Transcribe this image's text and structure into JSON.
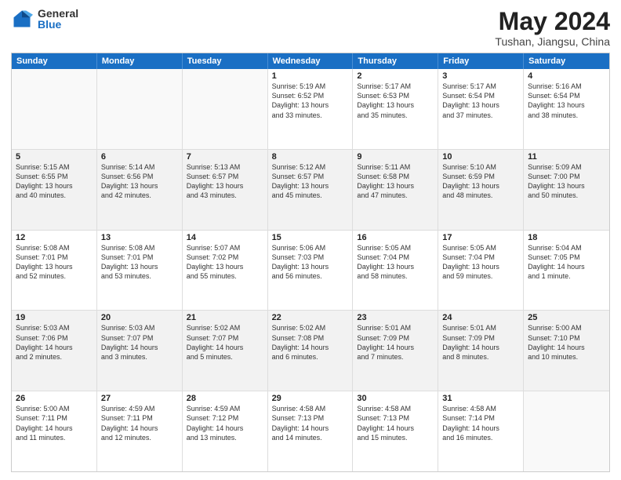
{
  "header": {
    "logo": {
      "general": "General",
      "blue": "Blue"
    },
    "title": "May 2024",
    "location": "Tushan, Jiangsu, China"
  },
  "weekdays": [
    "Sunday",
    "Monday",
    "Tuesday",
    "Wednesday",
    "Thursday",
    "Friday",
    "Saturday"
  ],
  "rows": [
    [
      {
        "day": "",
        "info": ""
      },
      {
        "day": "",
        "info": ""
      },
      {
        "day": "",
        "info": ""
      },
      {
        "day": "1",
        "info": "Sunrise: 5:19 AM\nSunset: 6:52 PM\nDaylight: 13 hours\nand 33 minutes."
      },
      {
        "day": "2",
        "info": "Sunrise: 5:17 AM\nSunset: 6:53 PM\nDaylight: 13 hours\nand 35 minutes."
      },
      {
        "day": "3",
        "info": "Sunrise: 5:17 AM\nSunset: 6:54 PM\nDaylight: 13 hours\nand 37 minutes."
      },
      {
        "day": "4",
        "info": "Sunrise: 5:16 AM\nSunset: 6:54 PM\nDaylight: 13 hours\nand 38 minutes."
      }
    ],
    [
      {
        "day": "5",
        "info": "Sunrise: 5:15 AM\nSunset: 6:55 PM\nDaylight: 13 hours\nand 40 minutes."
      },
      {
        "day": "6",
        "info": "Sunrise: 5:14 AM\nSunset: 6:56 PM\nDaylight: 13 hours\nand 42 minutes."
      },
      {
        "day": "7",
        "info": "Sunrise: 5:13 AM\nSunset: 6:57 PM\nDaylight: 13 hours\nand 43 minutes."
      },
      {
        "day": "8",
        "info": "Sunrise: 5:12 AM\nSunset: 6:57 PM\nDaylight: 13 hours\nand 45 minutes."
      },
      {
        "day": "9",
        "info": "Sunrise: 5:11 AM\nSunset: 6:58 PM\nDaylight: 13 hours\nand 47 minutes."
      },
      {
        "day": "10",
        "info": "Sunrise: 5:10 AM\nSunset: 6:59 PM\nDaylight: 13 hours\nand 48 minutes."
      },
      {
        "day": "11",
        "info": "Sunrise: 5:09 AM\nSunset: 7:00 PM\nDaylight: 13 hours\nand 50 minutes."
      }
    ],
    [
      {
        "day": "12",
        "info": "Sunrise: 5:08 AM\nSunset: 7:01 PM\nDaylight: 13 hours\nand 52 minutes."
      },
      {
        "day": "13",
        "info": "Sunrise: 5:08 AM\nSunset: 7:01 PM\nDaylight: 13 hours\nand 53 minutes."
      },
      {
        "day": "14",
        "info": "Sunrise: 5:07 AM\nSunset: 7:02 PM\nDaylight: 13 hours\nand 55 minutes."
      },
      {
        "day": "15",
        "info": "Sunrise: 5:06 AM\nSunset: 7:03 PM\nDaylight: 13 hours\nand 56 minutes."
      },
      {
        "day": "16",
        "info": "Sunrise: 5:05 AM\nSunset: 7:04 PM\nDaylight: 13 hours\nand 58 minutes."
      },
      {
        "day": "17",
        "info": "Sunrise: 5:05 AM\nSunset: 7:04 PM\nDaylight: 13 hours\nand 59 minutes."
      },
      {
        "day": "18",
        "info": "Sunrise: 5:04 AM\nSunset: 7:05 PM\nDaylight: 14 hours\nand 1 minute."
      }
    ],
    [
      {
        "day": "19",
        "info": "Sunrise: 5:03 AM\nSunset: 7:06 PM\nDaylight: 14 hours\nand 2 minutes."
      },
      {
        "day": "20",
        "info": "Sunrise: 5:03 AM\nSunset: 7:07 PM\nDaylight: 14 hours\nand 3 minutes."
      },
      {
        "day": "21",
        "info": "Sunrise: 5:02 AM\nSunset: 7:07 PM\nDaylight: 14 hours\nand 5 minutes."
      },
      {
        "day": "22",
        "info": "Sunrise: 5:02 AM\nSunset: 7:08 PM\nDaylight: 14 hours\nand 6 minutes."
      },
      {
        "day": "23",
        "info": "Sunrise: 5:01 AM\nSunset: 7:09 PM\nDaylight: 14 hours\nand 7 minutes."
      },
      {
        "day": "24",
        "info": "Sunrise: 5:01 AM\nSunset: 7:09 PM\nDaylight: 14 hours\nand 8 minutes."
      },
      {
        "day": "25",
        "info": "Sunrise: 5:00 AM\nSunset: 7:10 PM\nDaylight: 14 hours\nand 10 minutes."
      }
    ],
    [
      {
        "day": "26",
        "info": "Sunrise: 5:00 AM\nSunset: 7:11 PM\nDaylight: 14 hours\nand 11 minutes."
      },
      {
        "day": "27",
        "info": "Sunrise: 4:59 AM\nSunset: 7:11 PM\nDaylight: 14 hours\nand 12 minutes."
      },
      {
        "day": "28",
        "info": "Sunrise: 4:59 AM\nSunset: 7:12 PM\nDaylight: 14 hours\nand 13 minutes."
      },
      {
        "day": "29",
        "info": "Sunrise: 4:58 AM\nSunset: 7:13 PM\nDaylight: 14 hours\nand 14 minutes."
      },
      {
        "day": "30",
        "info": "Sunrise: 4:58 AM\nSunset: 7:13 PM\nDaylight: 14 hours\nand 15 minutes."
      },
      {
        "day": "31",
        "info": "Sunrise: 4:58 AM\nSunset: 7:14 PM\nDaylight: 14 hours\nand 16 minutes."
      },
      {
        "day": "",
        "info": ""
      }
    ]
  ]
}
